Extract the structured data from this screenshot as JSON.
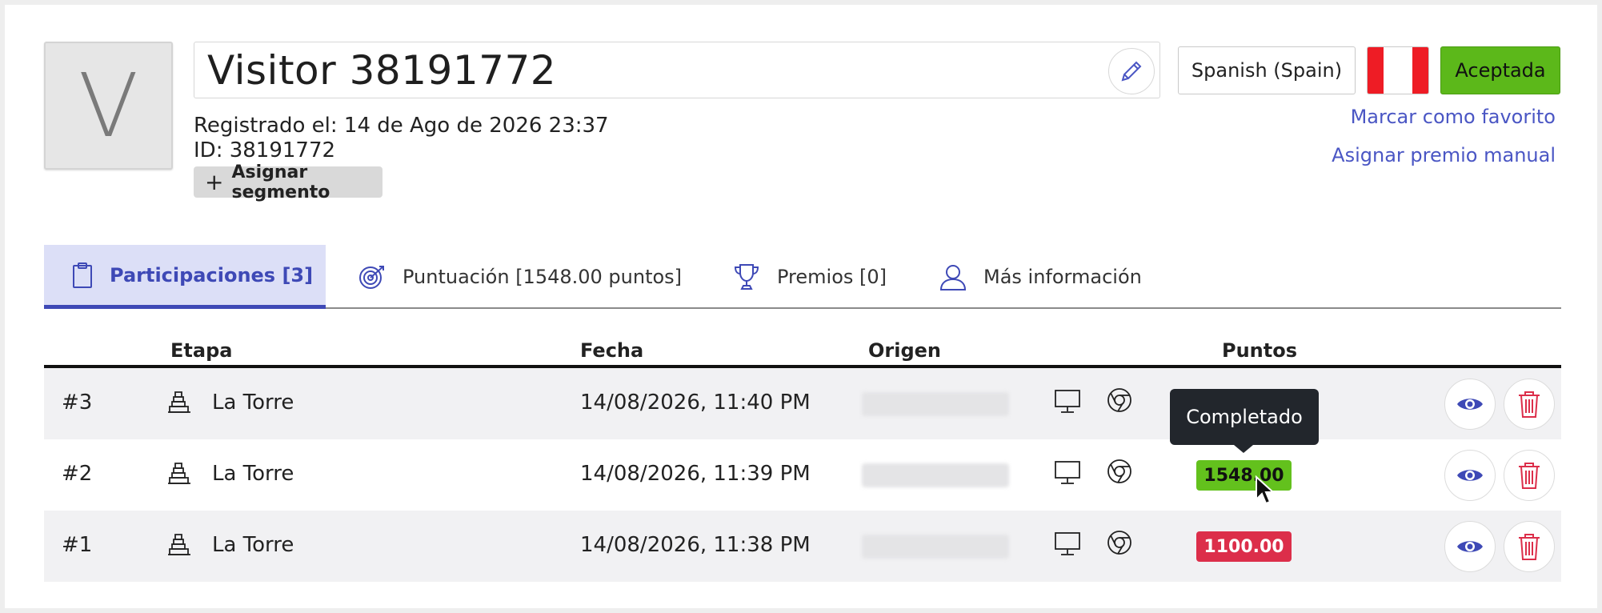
{
  "visitor": {
    "avatar_letter": "V",
    "name": "Visitor 38191772",
    "registered": "Registrado el: 14 de Ago de 2026 23:37",
    "id": "ID: 38191772",
    "assign_segment_label": "Asignar segmento"
  },
  "actions": {
    "language": "Spanish (Spain)",
    "status_button": "Aceptada",
    "mark_favorite": "Marcar como favorito",
    "assign_prize": "Asignar premio manual"
  },
  "tabs": [
    {
      "label": "Participaciones [3]",
      "icon": "clipboard-icon",
      "active": true
    },
    {
      "label": "Puntuación [1548.00 puntos]",
      "icon": "target-icon",
      "active": false
    },
    {
      "label": "Premios [0]",
      "icon": "trophy-icon",
      "active": false
    },
    {
      "label": "Más información",
      "icon": "user-icon",
      "active": false
    }
  ],
  "table": {
    "headers": {
      "stage": "Etapa",
      "date": "Fecha",
      "origin": "Origen",
      "points": "Puntos"
    },
    "rows": [
      {
        "num": "#3",
        "stage": "La Torre",
        "date": "14/08/2026, 11:40 PM",
        "points": "",
        "status": "none"
      },
      {
        "num": "#2",
        "stage": "La Torre",
        "date": "14/08/2026, 11:39 PM",
        "points": "1548.00",
        "status": "success"
      },
      {
        "num": "#1",
        "stage": "La Torre",
        "date": "14/08/2026, 11:38 PM",
        "points": "1100.00",
        "status": "danger"
      }
    ]
  },
  "tooltip": "Completado",
  "colors": {
    "accent": "#3e49b6",
    "link": "#4a56c4",
    "success": "#63c11d",
    "danger": "#dc2e4a",
    "accept": "#5cb81a"
  }
}
